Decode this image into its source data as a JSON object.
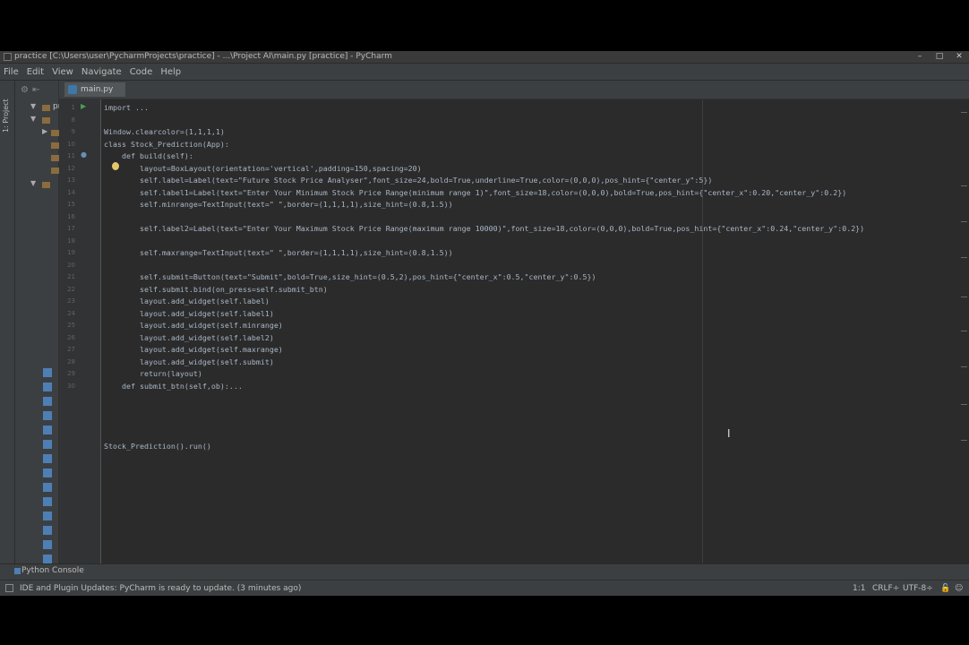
{
  "window": {
    "title": "practice [C:\\Users\\user\\PycharmProjects\\practice] - ...\\Project AI\\main.py [practice] - PyCharm",
    "controls": [
      "–",
      "□",
      "✕"
    ]
  },
  "menu": [
    "File",
    "Edit",
    "View",
    "Navigate",
    "Code",
    "Help"
  ],
  "project_panel": {
    "strip_label": "1: Project",
    "root": "prac"
  },
  "editor": {
    "tab": "main.py",
    "lines": [
      {
        "n": "1",
        "text": "import ..."
      },
      {
        "n": "8",
        "text": ""
      },
      {
        "n": "9",
        "text": "Window.clearcolor=(1,1,1,1)"
      },
      {
        "n": "10",
        "text": "class Stock_Prediction(App):"
      },
      {
        "n": "11",
        "text": "    def build(self):"
      },
      {
        "n": "12",
        "text": "        layout=BoxLayout(orientation='vertical',padding=150,spacing=20)"
      },
      {
        "n": "13",
        "text": "        self.label=Label(text=\"Future Stock Price Analyser\",font_size=24,bold=True,underline=True,color=(0,0,0),pos_hint={\"center_y\":5})"
      },
      {
        "n": "14",
        "text": "        self.label1=Label(text=\"Enter Your Minimum Stock Price Range(minimum range 1)\",font_size=18,color=(0,0,0),bold=True,pos_hint={\"center_x\":0.20,\"center_y\":0.2})"
      },
      {
        "n": "15",
        "text": "        self.minrange=TextInput(text=\" \",border=(1,1,1,1),size_hint=(0.8,1.5))"
      },
      {
        "n": "16",
        "text": ""
      },
      {
        "n": "17",
        "text": "        self.label2=Label(text=\"Enter Your Maximum Stock Price Range(maximum range 10000)\",font_size=18,color=(0,0,0),bold=True,pos_hint={\"center_x\":0.24,\"center_y\":0.2})"
      },
      {
        "n": "18",
        "text": ""
      },
      {
        "n": "19",
        "text": "        self.maxrange=TextInput(text=\" \",border=(1,1,1,1),size_hint=(0.8,1.5))"
      },
      {
        "n": "20",
        "text": ""
      },
      {
        "n": "21",
        "text": "        self.submit=Button(text=\"Submit\",bold=True,size_hint=(0.5,2),pos_hint={\"center_x\":0.5,\"center_y\":0.5})"
      },
      {
        "n": "22",
        "text": "        self.submit.bind(on_press=self.submit_btn)"
      },
      {
        "n": "23",
        "text": "        layout.add_widget(self.label)"
      },
      {
        "n": "24",
        "text": "        layout.add_widget(self.label1)"
      },
      {
        "n": "25",
        "text": "        layout.add_widget(self.minrange)"
      },
      {
        "n": "26",
        "text": "        layout.add_widget(self.label2)"
      },
      {
        "n": "27",
        "text": "        layout.add_widget(self.maxrange)"
      },
      {
        "n": "28",
        "text": "        layout.add_widget(self.submit)"
      },
      {
        "n": "29",
        "text": "        return(layout)"
      },
      {
        "n": "30",
        "text": "    def submit_btn(self,ob):..."
      },
      {
        "n": "",
        "text": ""
      },
      {
        "n": "",
        "text": ""
      },
      {
        "n": "",
        "text": ""
      },
      {
        "n": "",
        "text": ""
      },
      {
        "n": "",
        "text": "Stock_Prediction().run()"
      }
    ]
  },
  "bottom": {
    "console_tab": "Python Console"
  },
  "status": {
    "message": "IDE and Plugin Updates: PyCharm is ready to update. (3 minutes ago)",
    "position": "1:1",
    "line_sep": "CRLF÷",
    "encoding": "UTF-8÷"
  }
}
